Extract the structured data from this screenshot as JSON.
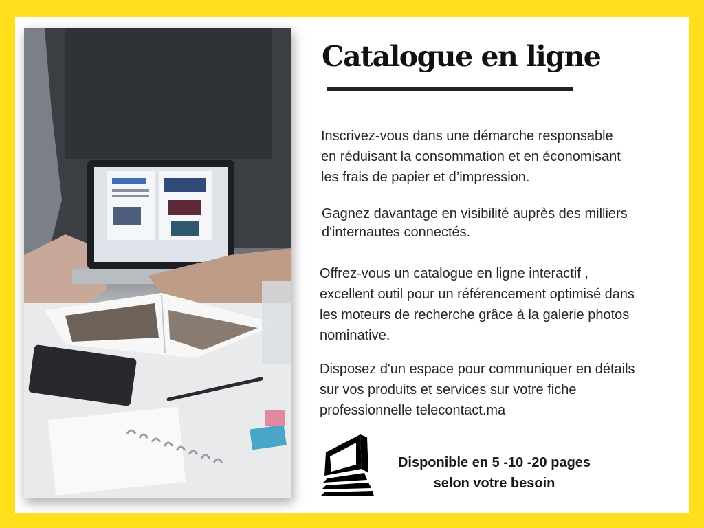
{
  "title": "Catalogue en ligne",
  "paragraphs": [
    "Inscrivez-vous dans une  démarche responsable\nen réduisant la consommation et en économisant\nles frais de papier et d’impression.",
    "Gagnez davantage en visibilité auprès des milliers\nd'internautes connectés.",
    "Offrez-vous un catalogue en ligne interactif ,\nexcellent outil pour un référencement optimisé dans\nles moteurs de recherche grâce à la galerie photos\nnominative.",
    "Disposez d'un espace pour communiquer en détails\nsur vos produits et services sur votre fiche\nprofessionnelle telecontact.ma"
  ],
  "availability": "Disponible en 5 -10 -20 pages\nselon votre besoin",
  "icons": {
    "book": "open-book-pages-icon"
  },
  "colors": {
    "background": "#ffdf1c",
    "card": "#ffffff",
    "text": "#262626",
    "title": "#111111"
  }
}
